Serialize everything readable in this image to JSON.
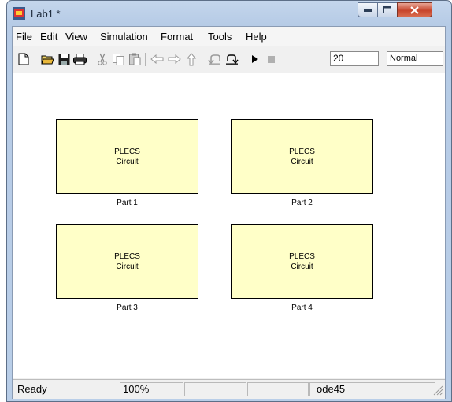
{
  "window": {
    "title": "Lab1 *"
  },
  "menu": [
    "File",
    "Edit",
    "View",
    "Simulation",
    "Format",
    "Tools",
    "Help"
  ],
  "toolbar": {
    "stop_time": "20",
    "sim_mode": "Normal",
    "icons": [
      "new-icon",
      "open-icon",
      "save-icon",
      "print-icon",
      "cut-icon",
      "copy-icon",
      "paste-icon",
      "back-icon",
      "forward-icon",
      "up-icon",
      "undo-icon",
      "redo-icon",
      "play-icon",
      "stop-icon"
    ]
  },
  "blocks": [
    {
      "line1": "PLECS",
      "line2": "Circuit",
      "label": "Part 1"
    },
    {
      "line1": "PLECS",
      "line2": "Circuit",
      "label": "Part 2"
    },
    {
      "line1": "PLECS",
      "line2": "Circuit",
      "label": "Part 3"
    },
    {
      "line1": "PLECS",
      "line2": "Circuit",
      "label": "Part 4"
    }
  ],
  "status": {
    "state": "Ready",
    "zoom": "100%",
    "solver": "ode45"
  },
  "colors": {
    "block_fill": "#ffffc8",
    "close_button": "#c7452c"
  }
}
